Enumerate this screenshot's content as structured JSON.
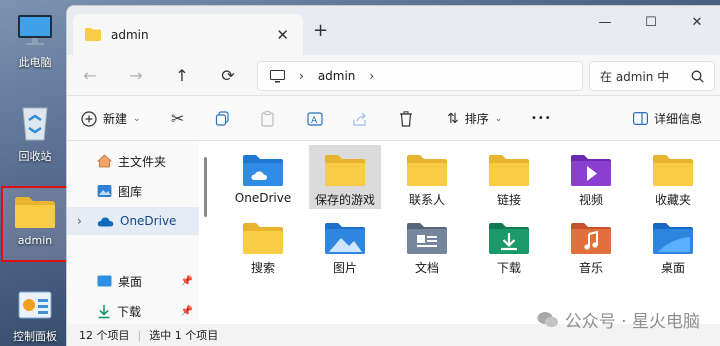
{
  "desktop": {
    "icons": [
      {
        "label": "此电脑"
      },
      {
        "label": "回收站"
      },
      {
        "label": "admin"
      },
      {
        "label": "控制面板"
      }
    ]
  },
  "window": {
    "tab_title": "admin",
    "address": {
      "segment": "admin"
    },
    "search": {
      "placeholder": "在 admin 中"
    },
    "toolbar": {
      "new_label": "新建",
      "sort_label": "排序",
      "more_label": "•••",
      "details_label": "详细信息"
    },
    "sidebar": {
      "items": [
        {
          "label": "主文件夹"
        },
        {
          "label": "图库"
        },
        {
          "label": "OneDrive"
        },
        {
          "label": "桌面"
        },
        {
          "label": "下载"
        }
      ]
    },
    "files": [
      {
        "name": "OneDrive",
        "icon": "onedrive-folder-icon"
      },
      {
        "name": "保存的游戏",
        "icon": "folder-icon"
      },
      {
        "name": "联系人",
        "icon": "folder-icon"
      },
      {
        "name": "链接",
        "icon": "folder-icon"
      },
      {
        "name": "视频",
        "icon": "videos-folder-icon"
      },
      {
        "name": "收藏夹",
        "icon": "folder-icon"
      },
      {
        "name": "搜索",
        "icon": "folder-icon"
      },
      {
        "name": "图片",
        "icon": "pictures-folder-icon"
      },
      {
        "name": "文档",
        "icon": "documents-folder-icon"
      },
      {
        "name": "下载",
        "icon": "downloads-folder-icon"
      },
      {
        "name": "音乐",
        "icon": "music-folder-icon"
      },
      {
        "name": "桌面",
        "icon": "desktop-folder-icon"
      }
    ],
    "status": {
      "item_count": "12 个项目",
      "selected": "选中 1 个项目"
    }
  },
  "watermark": "公众号 · 星火电脑",
  "colors": {
    "folder": "#f9cc45",
    "selection_outline": "#e01010",
    "accent": "#0067c0"
  }
}
